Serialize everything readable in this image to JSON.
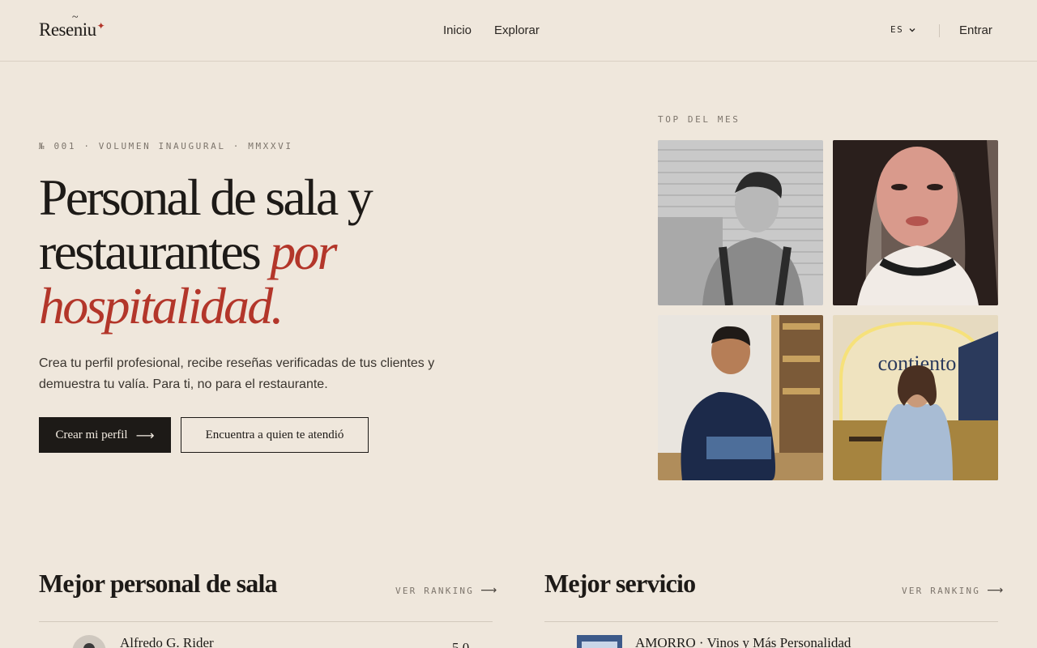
{
  "header": {
    "logo": "Reseniu",
    "nav": [
      "Inicio",
      "Explorar"
    ],
    "lang": "ES",
    "login": "Entrar"
  },
  "hero": {
    "issue": "№ 001 · VOLUMEN INAUGURAL · MMXXVI",
    "title_line1": "Personal de sala y",
    "title_line2": "restaurantes",
    "title_accent1": "por",
    "title_accent2": "hospitalidad.",
    "lead": "Crea tu perfil profesional, recibe reseñas verificadas de tus clientes y demuestra tu valía. Para ti, no para el restaurante.",
    "cta_primary": "Crear mi perfil",
    "cta_secondary": "Encuentra a quien te atendió"
  },
  "top": {
    "label": "TOP DEL MES",
    "sign_text": "contiento"
  },
  "sections": [
    {
      "title": "Mejor personal de sala",
      "link": "VER RANKING",
      "first_row": "Alfredo G. Rider",
      "score": "5.0"
    },
    {
      "title": "Mejor servicio",
      "link": "VER RANKING",
      "first_row": "AMORRO · Vinos y Más Personalidad"
    }
  ],
  "colors": {
    "accent": "#b3362a",
    "background": "#efe7dc",
    "ink": "#1d1a17"
  }
}
